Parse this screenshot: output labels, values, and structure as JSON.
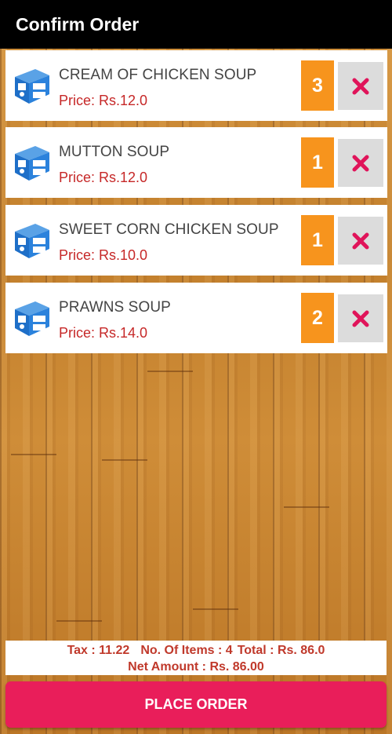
{
  "app_bar": {
    "title": "Confirm Order"
  },
  "items": [
    {
      "name": "CREAM OF CHICKEN SOUP",
      "price": "Price: Rs.12.0",
      "qty": "3",
      "icon": "food-box-icon",
      "remove_icon": "close-icon"
    },
    {
      "name": "MUTTON SOUP",
      "price": "Price: Rs.12.0",
      "qty": "1",
      "icon": "food-box-icon",
      "remove_icon": "close-icon"
    },
    {
      "name": "SWEET CORN CHICKEN SOUP",
      "price": "Price: Rs.10.0",
      "qty": "1",
      "icon": "food-box-icon",
      "remove_icon": "close-icon"
    },
    {
      "name": "PRAWNS SOUP",
      "price": "Price: Rs.14.0",
      "qty": "2",
      "icon": "food-box-icon",
      "remove_icon": "close-icon"
    }
  ],
  "summary": {
    "tax": "Tax : 11.22",
    "items_count": "No. Of Items : 4",
    "total": "Total : Rs. 86.0",
    "net_amount": "Net Amount : Rs. 86.00"
  },
  "place_order": {
    "label": "PLACE ORDER"
  },
  "colors": {
    "app_bar": "#000000",
    "price_text": "#c62828",
    "qty_badge": "#f7941d",
    "remove_bg": "#dcdcdc",
    "remove_icon": "#e0145a",
    "place_order": "#e91e5a",
    "icon_blue": "#1e6fc8"
  }
}
